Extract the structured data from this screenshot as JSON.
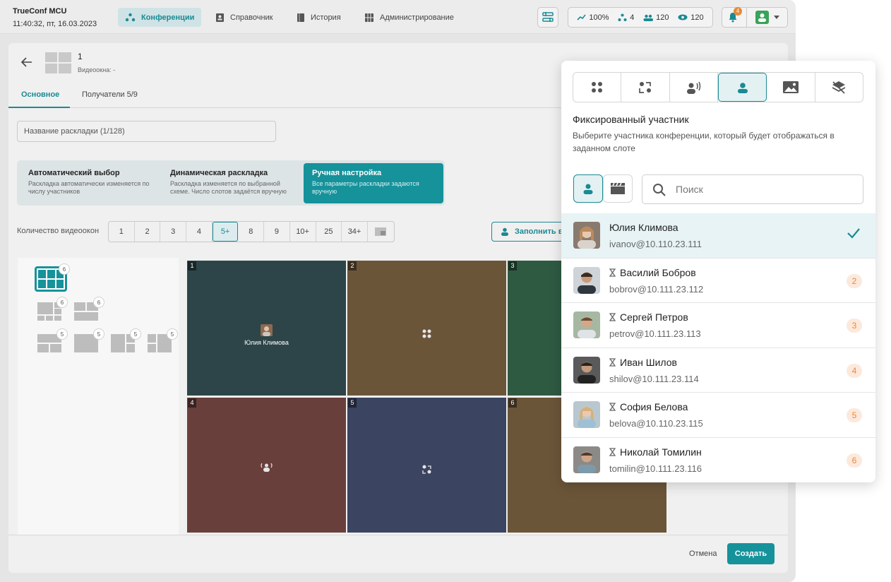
{
  "app": {
    "name": "TrueConf MCU",
    "datetime": "11:40:32, пт, 16.03.2023"
  },
  "nav": [
    {
      "label": "Конференции",
      "icon": "conference-icon",
      "active": true
    },
    {
      "label": "Справочник",
      "icon": "contacts-icon"
    },
    {
      "label": "История",
      "icon": "history-icon"
    },
    {
      "label": "Администрирование",
      "icon": "admin-icon"
    }
  ],
  "stats": {
    "load": "100%",
    "conferences": "4",
    "users": "120",
    "views": "120"
  },
  "notifications_count": "4",
  "layout": {
    "title": "1",
    "subtitle": "Видеоокна: -"
  },
  "tabs": [
    {
      "label": "Основное",
      "active": true
    },
    {
      "label": "Получатели 5/9"
    }
  ],
  "name_placeholder": "Название раскладки (1/128)",
  "modes": [
    {
      "title": "Автоматический выбор",
      "desc": "Раскладка автоматически изменяется по числу участников"
    },
    {
      "title": "Динамическая раскладка",
      "desc": "Раскладка изменяется по выбранной схеме. Число слотов задаётся вручную"
    },
    {
      "title": "Ручная настройка",
      "desc": "Все параметры раскладки задаются вручную",
      "active": true
    }
  ],
  "count_label": "Количество видеоокон",
  "counts": [
    "1",
    "2",
    "3",
    "4",
    "5+",
    "8",
    "9",
    "10+",
    "25",
    "34+"
  ],
  "counts_active": "5+",
  "fill_button": "Заполнить в",
  "layout_badges": [
    "6",
    "6",
    "6",
    "5",
    "5",
    "5",
    "5"
  ],
  "slots": [
    {
      "num": "1",
      "color": "#2d4548",
      "type": "participant",
      "label": "Юлия Климова"
    },
    {
      "num": "2",
      "color": "#6b5539",
      "type": "auto"
    },
    {
      "num": "3",
      "color": "#2f5a42",
      "type": "none"
    },
    {
      "num": "4",
      "color": "#693f3c",
      "type": "speaker"
    },
    {
      "num": "5",
      "color": "#3b4460",
      "type": "switch"
    },
    {
      "num": "6",
      "color": "#6b5539",
      "type": "none"
    }
  ],
  "footer": {
    "cancel": "Отмена",
    "create": "Создать"
  },
  "popup": {
    "title": "Фиксированный участник",
    "desc": "Выберите участника конференции, который будет отображаться в заданном слоте",
    "search_placeholder": "Поиск",
    "participants": [
      {
        "name": "Юлия Климова",
        "email": "ivanov@10.110.23.111",
        "selected": true
      },
      {
        "name": "Василий Бобров",
        "email": "bobrov@10.111.23.112",
        "slot": "2"
      },
      {
        "name": "Сергей Петров",
        "email": "petrov@10.111.23.113",
        "slot": "3"
      },
      {
        "name": "Иван Шилов",
        "email": "shilov@10.111.23.114",
        "slot": "4"
      },
      {
        "name": "София Белова",
        "email": "belova@10.110.23.115",
        "slot": "5"
      },
      {
        "name": "Николай Томилин",
        "email": "tomilin@10.111.23.116",
        "slot": "6"
      }
    ]
  },
  "colors": {
    "accent": "#16929b",
    "badge": "#e8893a"
  }
}
